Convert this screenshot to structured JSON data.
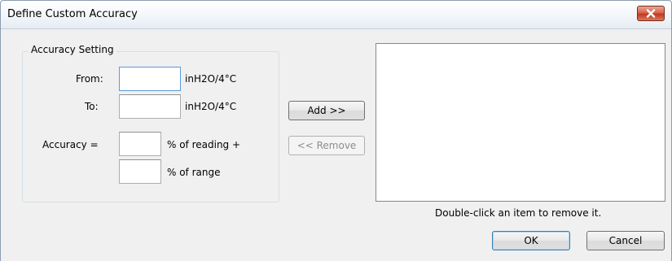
{
  "window": {
    "title": "Define Custom Accuracy"
  },
  "group": {
    "legend": "Accuracy Setting",
    "from_label": "From:",
    "from_value": "",
    "from_unit": "inH2O/4°C",
    "to_label": "To:",
    "to_value": "",
    "to_unit": "inH2O/4°C",
    "accuracy_label": "Accuracy =",
    "reading_value": "",
    "reading_suffix": "% of reading +",
    "range_value": "",
    "range_suffix": "% of range"
  },
  "actions": {
    "add_label": "Add >>",
    "remove_label": "<< Remove",
    "remove_enabled": false
  },
  "list": {
    "items": [],
    "hint": "Double-click an item to remove it."
  },
  "footer": {
    "ok_label": "OK",
    "cancel_label": "Cancel"
  },
  "colors": {
    "close_button": "#c2391f",
    "focus_border": "#5a9bd5",
    "dialog_background": "#f0f0f0"
  }
}
